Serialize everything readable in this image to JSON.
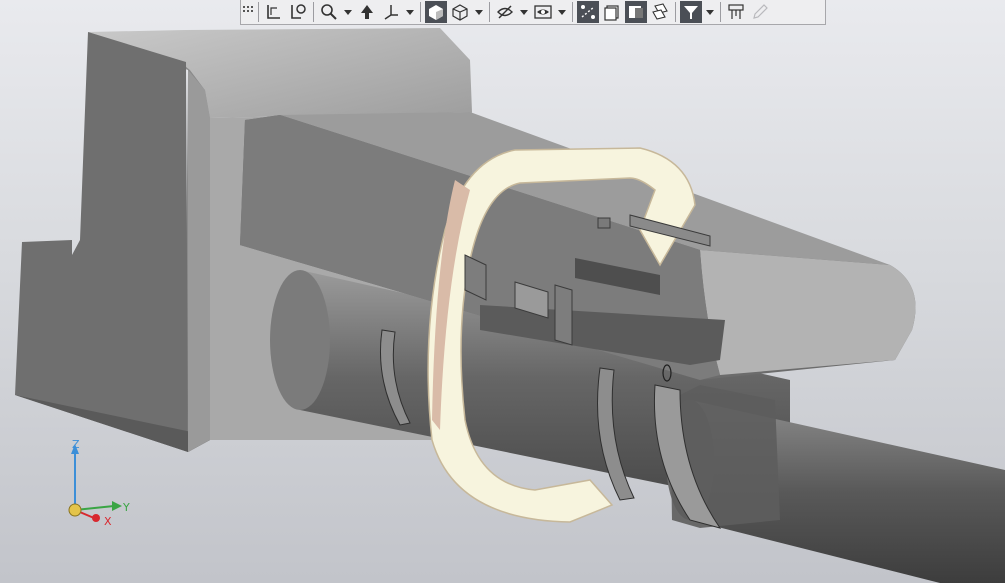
{
  "app": {
    "view": "3d-model-viewport",
    "background_top": "#e9eaee",
    "background_bottom": "#c2c4ca"
  },
  "toolbar": {
    "items": [
      {
        "name": "toolbar-grip",
        "icon": "grip-icon"
      },
      {
        "name": "sketch-button",
        "icon": "sketch-icon"
      },
      {
        "name": "sketch-settings-button",
        "icon": "sketch-settings-icon"
      },
      {
        "name": "zoom-button",
        "icon": "magnifier-icon"
      },
      {
        "name": "zoom-dropdown",
        "icon": "chevron-down-icon"
      },
      {
        "name": "orient-button",
        "icon": "orient-icon"
      },
      {
        "name": "axes-button",
        "icon": "axes-icon"
      },
      {
        "name": "axes-dropdown",
        "icon": "chevron-down-icon"
      },
      {
        "name": "shaded-view-button",
        "icon": "shaded-cube-icon",
        "active": true
      },
      {
        "name": "wireframe-view-button",
        "icon": "wireframe-cube-icon"
      },
      {
        "name": "display-dropdown",
        "icon": "chevron-down-icon"
      },
      {
        "name": "hide-button",
        "icon": "eye-hidden-icon"
      },
      {
        "name": "hide-dropdown",
        "icon": "chevron-down-icon"
      },
      {
        "name": "show-button",
        "icon": "eye-show-icon"
      },
      {
        "name": "show-dropdown",
        "icon": "chevron-down-icon"
      },
      {
        "name": "constraints-button",
        "icon": "constraint-icon",
        "active": true
      },
      {
        "name": "layers-button",
        "icon": "layers-icon"
      },
      {
        "name": "section-button",
        "icon": "section-icon",
        "active": true
      },
      {
        "name": "explode-button",
        "icon": "explode-icon"
      },
      {
        "name": "filter-button",
        "icon": "filter-icon",
        "active": true
      },
      {
        "name": "filter-dropdown",
        "icon": "chevron-down-icon"
      },
      {
        "name": "measure-button",
        "icon": "measure-icon"
      },
      {
        "name": "edit-button",
        "icon": "pencil-icon",
        "disabled": true
      }
    ]
  },
  "triad": {
    "z": "Z",
    "y": "Y",
    "x": "X",
    "z_color": "#3c8fd8",
    "y_color": "#3aa544",
    "x_color": "#d8282f"
  }
}
